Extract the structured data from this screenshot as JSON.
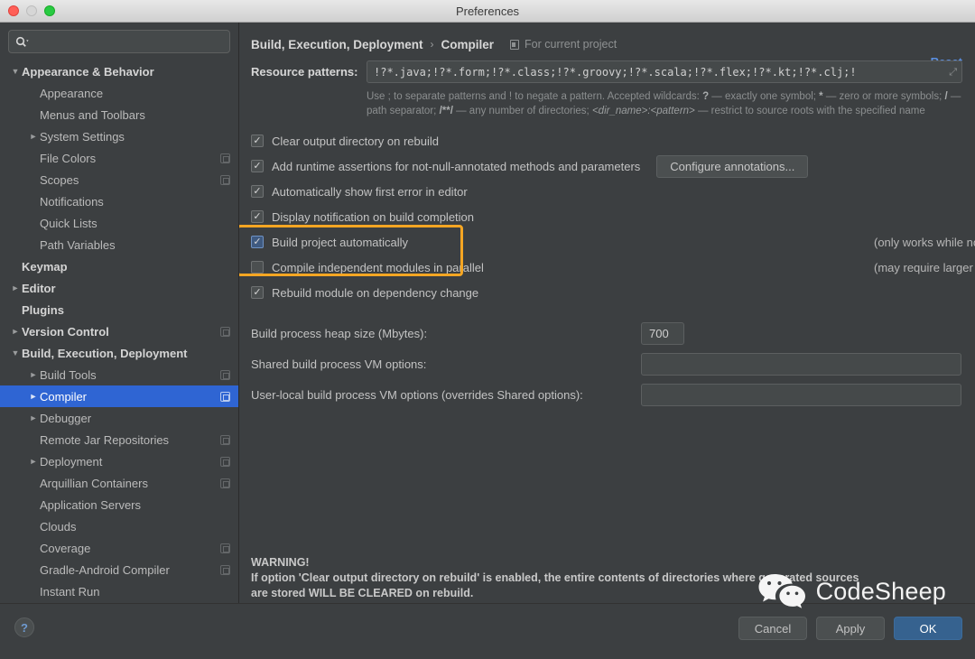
{
  "window": {
    "title": "Preferences"
  },
  "traffic_lights": [
    {
      "name": "close",
      "color": "#ff5f57"
    },
    {
      "name": "minimize",
      "color": "#d6d6d6"
    },
    {
      "name": "maximize",
      "color": "#28ca42"
    }
  ],
  "sidebar": {
    "search": {
      "value": "",
      "placeholder": ""
    },
    "items": [
      {
        "label": "Appearance & Behavior",
        "indent": 0,
        "arrow": "down",
        "bold": true,
        "project": false,
        "selected": false
      },
      {
        "label": "Appearance",
        "indent": 1,
        "arrow": "none",
        "bold": false,
        "project": false,
        "selected": false
      },
      {
        "label": "Menus and Toolbars",
        "indent": 1,
        "arrow": "none",
        "bold": false,
        "project": false,
        "selected": false
      },
      {
        "label": "System Settings",
        "indent": 1,
        "arrow": "right",
        "bold": false,
        "project": false,
        "selected": false
      },
      {
        "label": "File Colors",
        "indent": 1,
        "arrow": "none",
        "bold": false,
        "project": true,
        "selected": false
      },
      {
        "label": "Scopes",
        "indent": 1,
        "arrow": "none",
        "bold": false,
        "project": true,
        "selected": false
      },
      {
        "label": "Notifications",
        "indent": 1,
        "arrow": "none",
        "bold": false,
        "project": false,
        "selected": false
      },
      {
        "label": "Quick Lists",
        "indent": 1,
        "arrow": "none",
        "bold": false,
        "project": false,
        "selected": false
      },
      {
        "label": "Path Variables",
        "indent": 1,
        "arrow": "none",
        "bold": false,
        "project": false,
        "selected": false
      },
      {
        "label": "Keymap",
        "indent": 0,
        "arrow": "none",
        "bold": true,
        "project": false,
        "selected": false
      },
      {
        "label": "Editor",
        "indent": 0,
        "arrow": "right",
        "bold": true,
        "project": false,
        "selected": false
      },
      {
        "label": "Plugins",
        "indent": 0,
        "arrow": "none",
        "bold": true,
        "project": false,
        "selected": false
      },
      {
        "label": "Version Control",
        "indent": 0,
        "arrow": "right",
        "bold": true,
        "project": true,
        "selected": false
      },
      {
        "label": "Build, Execution, Deployment",
        "indent": 0,
        "arrow": "down",
        "bold": true,
        "project": false,
        "selected": false
      },
      {
        "label": "Build Tools",
        "indent": 1,
        "arrow": "right",
        "bold": false,
        "project": true,
        "selected": false
      },
      {
        "label": "Compiler",
        "indent": 1,
        "arrow": "right",
        "bold": false,
        "project": true,
        "selected": true
      },
      {
        "label": "Debugger",
        "indent": 1,
        "arrow": "right",
        "bold": false,
        "project": false,
        "selected": false
      },
      {
        "label": "Remote Jar Repositories",
        "indent": 1,
        "arrow": "none",
        "bold": false,
        "project": true,
        "selected": false
      },
      {
        "label": "Deployment",
        "indent": 1,
        "arrow": "right",
        "bold": false,
        "project": true,
        "selected": false
      },
      {
        "label": "Arquillian Containers",
        "indent": 1,
        "arrow": "none",
        "bold": false,
        "project": true,
        "selected": false
      },
      {
        "label": "Application Servers",
        "indent": 1,
        "arrow": "none",
        "bold": false,
        "project": false,
        "selected": false
      },
      {
        "label": "Clouds",
        "indent": 1,
        "arrow": "none",
        "bold": false,
        "project": false,
        "selected": false
      },
      {
        "label": "Coverage",
        "indent": 1,
        "arrow": "none",
        "bold": false,
        "project": true,
        "selected": false
      },
      {
        "label": "Gradle-Android Compiler",
        "indent": 1,
        "arrow": "none",
        "bold": false,
        "project": true,
        "selected": false
      },
      {
        "label": "Instant Run",
        "indent": 1,
        "arrow": "none",
        "bold": false,
        "project": false,
        "selected": false
      }
    ]
  },
  "header": {
    "breadcrumb_root": "Build, Execution, Deployment",
    "breadcrumb_sep": "›",
    "breadcrumb_leaf": "Compiler",
    "for_current_project": "For current project",
    "reset_label": "Reset"
  },
  "resource_patterns": {
    "label": "Resource patterns:",
    "value": "!?*.java;!?*.form;!?*.class;!?*.groovy;!?*.scala;!?*.flex;!?*.kt;!?*.clj;!",
    "hint_1": "Use ; to separate patterns and ! to negate a pattern. Accepted wildcards: ",
    "hint_q": "?",
    "hint_2": " — exactly one symbol; ",
    "hint_star": "*",
    "hint_3": " — zero or more symbols; ",
    "hint_slash": "/",
    "hint_4": " — path separator; ",
    "hint_globstar": "/**/",
    "hint_5": " — any number of directories; ",
    "hint_dirname": "<dir_name>:<pattern>",
    "hint_6": " — restrict to source roots with the specified name"
  },
  "options": [
    {
      "label": "Clear output directory on rebuild",
      "checked": true,
      "focused": false,
      "note": "",
      "button": ""
    },
    {
      "label": "Add runtime assertions for not-null-annotated methods and parameters",
      "checked": true,
      "focused": false,
      "note": "",
      "button": "Configure annotations..."
    },
    {
      "label": "Automatically show first error in editor",
      "checked": true,
      "focused": false,
      "note": "",
      "button": ""
    },
    {
      "label": "Display notification on build completion",
      "checked": true,
      "focused": false,
      "note": "",
      "button": ""
    },
    {
      "label": "Build project automatically",
      "checked": true,
      "focused": true,
      "note": "(only works while not running / debugging)",
      "button": ""
    },
    {
      "label": "Compile independent modules in parallel",
      "checked": false,
      "focused": false,
      "note": "(may require larger heap size)",
      "button": ""
    },
    {
      "label": "Rebuild module on dependency change",
      "checked": true,
      "focused": false,
      "note": "",
      "button": ""
    }
  ],
  "fields": [
    {
      "label": "Build process heap size (Mbytes):",
      "value": "700",
      "size": "small"
    },
    {
      "label": "Shared build process VM options:",
      "value": "",
      "size": "wide"
    },
    {
      "label": "User-local build process VM options (overrides Shared options):",
      "value": "",
      "size": "wide"
    }
  ],
  "warning": {
    "title": "WARNING!",
    "line1": "If option 'Clear output directory on rebuild' is enabled, the entire contents of directories where generated sources",
    "line2": "are stored WILL BE CLEARED on rebuild."
  },
  "footer": {
    "help_label": "?",
    "cancel_label": "Cancel",
    "apply_label": "Apply",
    "ok_label": "OK"
  },
  "watermark": {
    "text": "CodeSheep"
  },
  "colors": {
    "background": "#3c3f41",
    "selection_blue": "#2f65d3",
    "accent_link": "#5b8fe0",
    "highlight_orange": "#f5a623",
    "ok_button": "#36628f"
  }
}
